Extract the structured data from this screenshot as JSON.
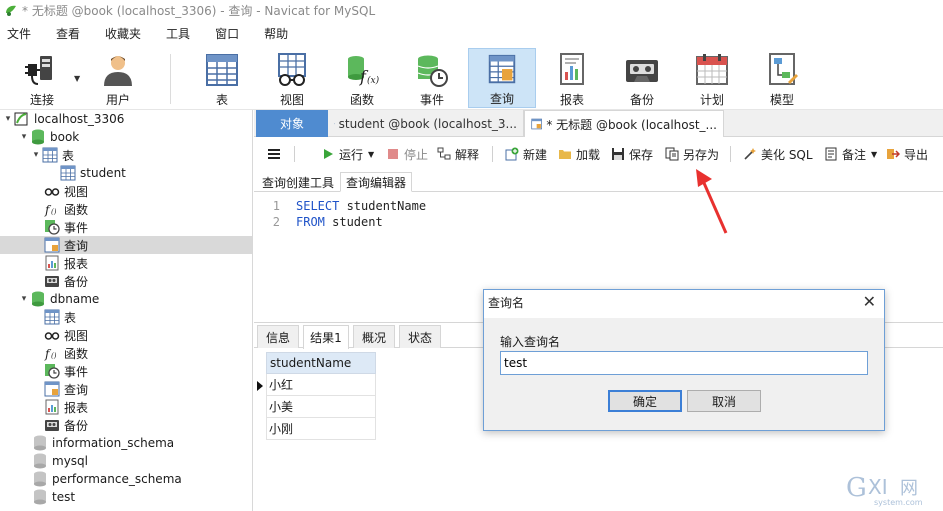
{
  "titlebar": {
    "title": "* 无标题 @book (localhost_3306) - 查询 - Navicat for MySQL"
  },
  "menu": [
    "文件",
    "查看",
    "收藏夹",
    "工具",
    "窗口",
    "帮助"
  ],
  "toolbar": {
    "buttons": [
      {
        "label": "连接",
        "icon": "plug-icon"
      },
      {
        "label": "用户",
        "icon": "user-icon"
      },
      {
        "label": "表",
        "icon": "table-icon"
      },
      {
        "label": "视图",
        "icon": "view-icon"
      },
      {
        "label": "函数",
        "icon": "function-icon"
      },
      {
        "label": "事件",
        "icon": "event-icon"
      },
      {
        "label": "查询",
        "icon": "query-icon",
        "active": true
      },
      {
        "label": "报表",
        "icon": "report-icon"
      },
      {
        "label": "备份",
        "icon": "backup-icon"
      },
      {
        "label": "计划",
        "icon": "schedule-icon"
      },
      {
        "label": "模型",
        "icon": "model-icon"
      }
    ]
  },
  "tree": [
    {
      "label": "localhost_3306"
    },
    {
      "label": "book"
    },
    {
      "label": "表"
    },
    {
      "label": "student"
    },
    {
      "label": "视图"
    },
    {
      "label": "函数"
    },
    {
      "label": "事件"
    },
    {
      "label": "查询",
      "selected": true
    },
    {
      "label": "报表"
    },
    {
      "label": "备份"
    },
    {
      "label": "dbname"
    },
    {
      "label": "表"
    },
    {
      "label": "视图"
    },
    {
      "label": "函数"
    },
    {
      "label": "事件"
    },
    {
      "label": "查询"
    },
    {
      "label": "报表"
    },
    {
      "label": "备份"
    },
    {
      "label": "information_schema"
    },
    {
      "label": "mysql"
    },
    {
      "label": "performance_schema"
    },
    {
      "label": "test"
    }
  ],
  "tabs": {
    "objects": "对象",
    "student": "student @book (localhost_3...",
    "untitled": "* 无标题 @book (localhost_..."
  },
  "query_toolbar": {
    "run": "运行",
    "stop": "停止",
    "explain": "解释",
    "new": "新建",
    "load": "加载",
    "save": "保存",
    "save_as": "另存为",
    "beautify": "美化 SQL",
    "comment": "备注",
    "export": "导出"
  },
  "subtabs": {
    "builder": "查询创建工具",
    "editor": "查询编辑器"
  },
  "editor": {
    "lines": [
      {
        "num": "1",
        "kw": "SELECT",
        "rest": " studentName"
      },
      {
        "num": "2",
        "kw": "FROM",
        "rest": " student"
      }
    ]
  },
  "result_tabs": [
    "信息",
    "结果1",
    "概况",
    "状态"
  ],
  "grid": {
    "column": "studentName",
    "rows": [
      "小红",
      "小美",
      "小刚"
    ]
  },
  "dialog": {
    "title": "查询名",
    "label": "输入查询名",
    "value": "test",
    "ok": "确定",
    "cancel": "取消"
  },
  "colors": {
    "accent": "#4f8bd0",
    "active_toolbar": "#cde4f7",
    "arrow": "#e8312f",
    "keyword": "#1f53c8"
  }
}
